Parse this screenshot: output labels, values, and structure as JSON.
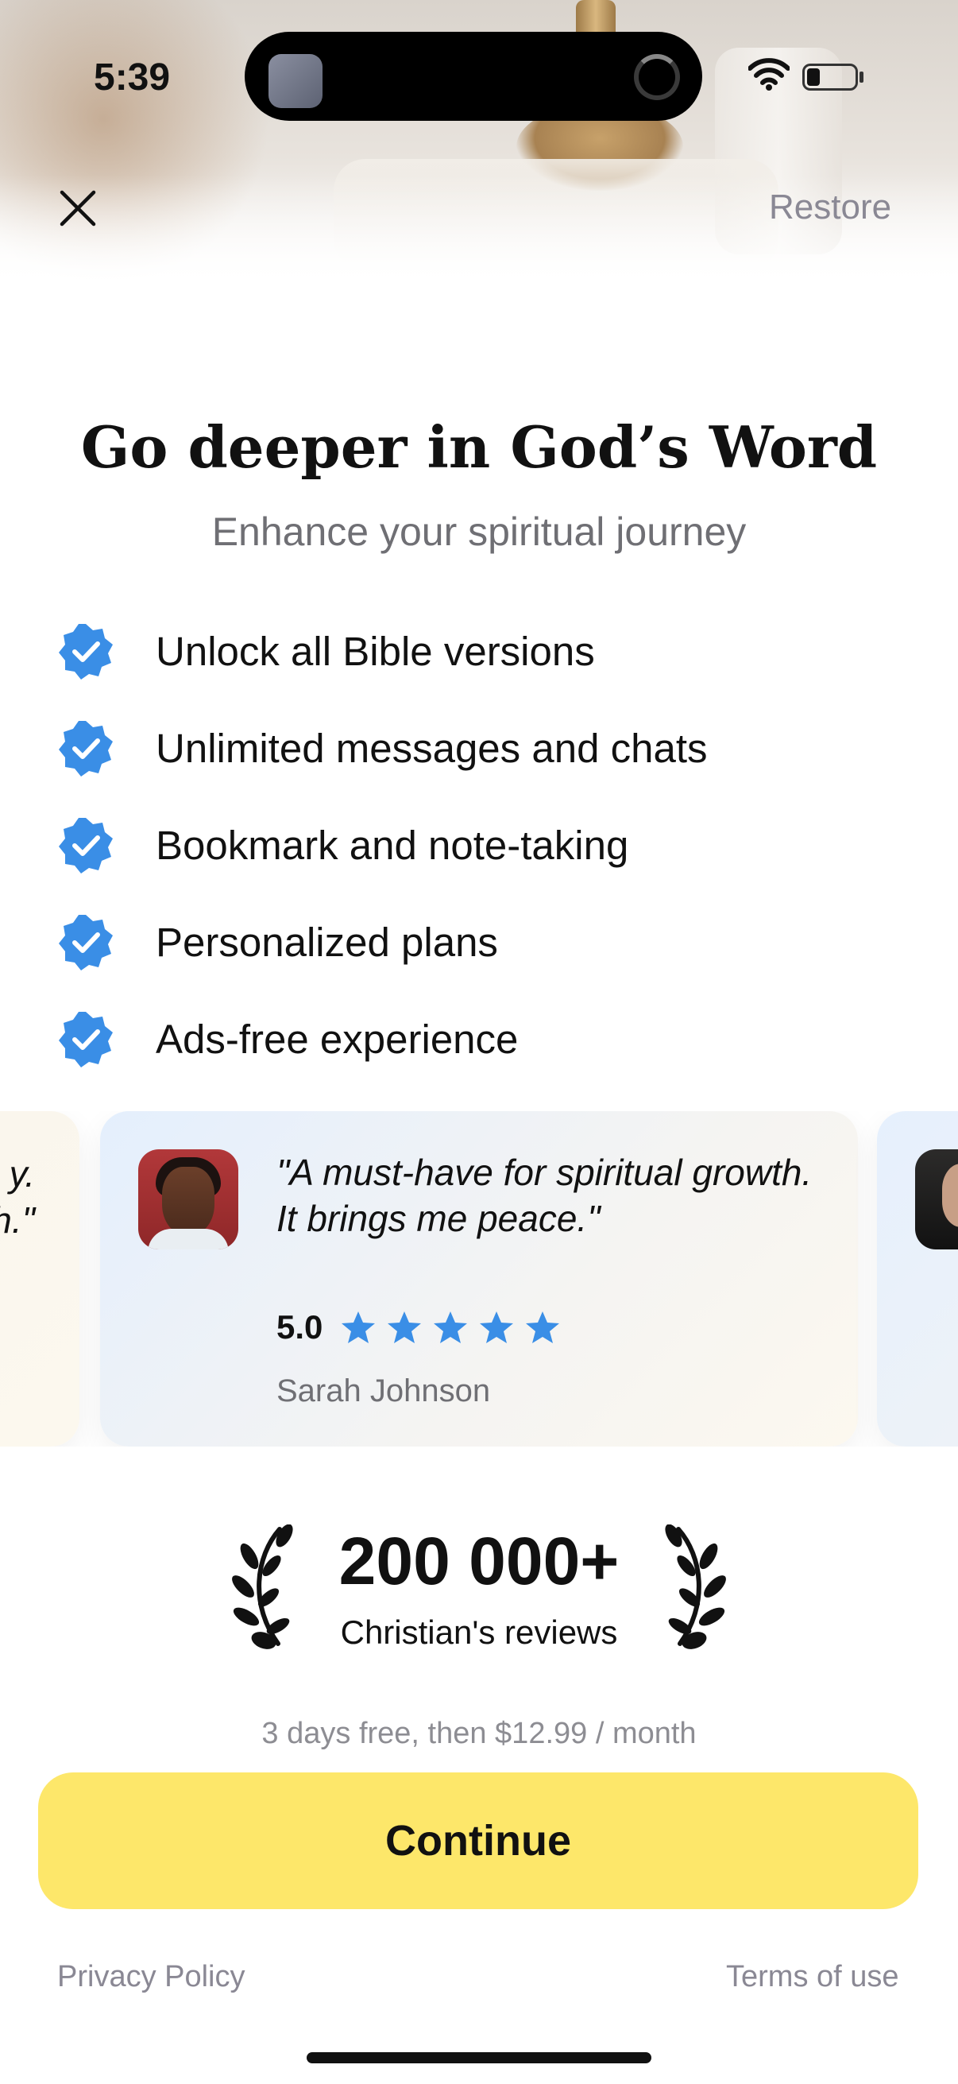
{
  "status_bar": {
    "time": "5:39"
  },
  "header": {
    "restore_label": "Restore"
  },
  "title": "Go deeper in God’s Word",
  "subtitle": "Enhance your spiritual journey",
  "features": [
    {
      "label": "Unlock all Bible versions"
    },
    {
      "label": "Unlimited messages and chats"
    },
    {
      "label": "Bookmark and note-taking"
    },
    {
      "label": "Personalized plans"
    },
    {
      "label": "Ads-free experience"
    }
  ],
  "reviews": {
    "partial_left_text": "y.\nh.\"",
    "main": {
      "quote": "\"A must-have for spiritual growth. It brings me peace.\"",
      "rating": "5.0",
      "stars": 5,
      "reviewer": "Sarah Johnson"
    }
  },
  "stats": {
    "count": "200 000+",
    "label": "Christian's reviews"
  },
  "pricing_text": "3 days free, then $12.99 / month",
  "cta": {
    "continue_label": "Continue"
  },
  "footer": {
    "privacy_label": "Privacy Policy",
    "terms_label": "Terms of use"
  },
  "colors": {
    "accent_blue": "#3a8ee6",
    "cta_yellow": "#fde76a",
    "muted_text": "#8a8894"
  }
}
